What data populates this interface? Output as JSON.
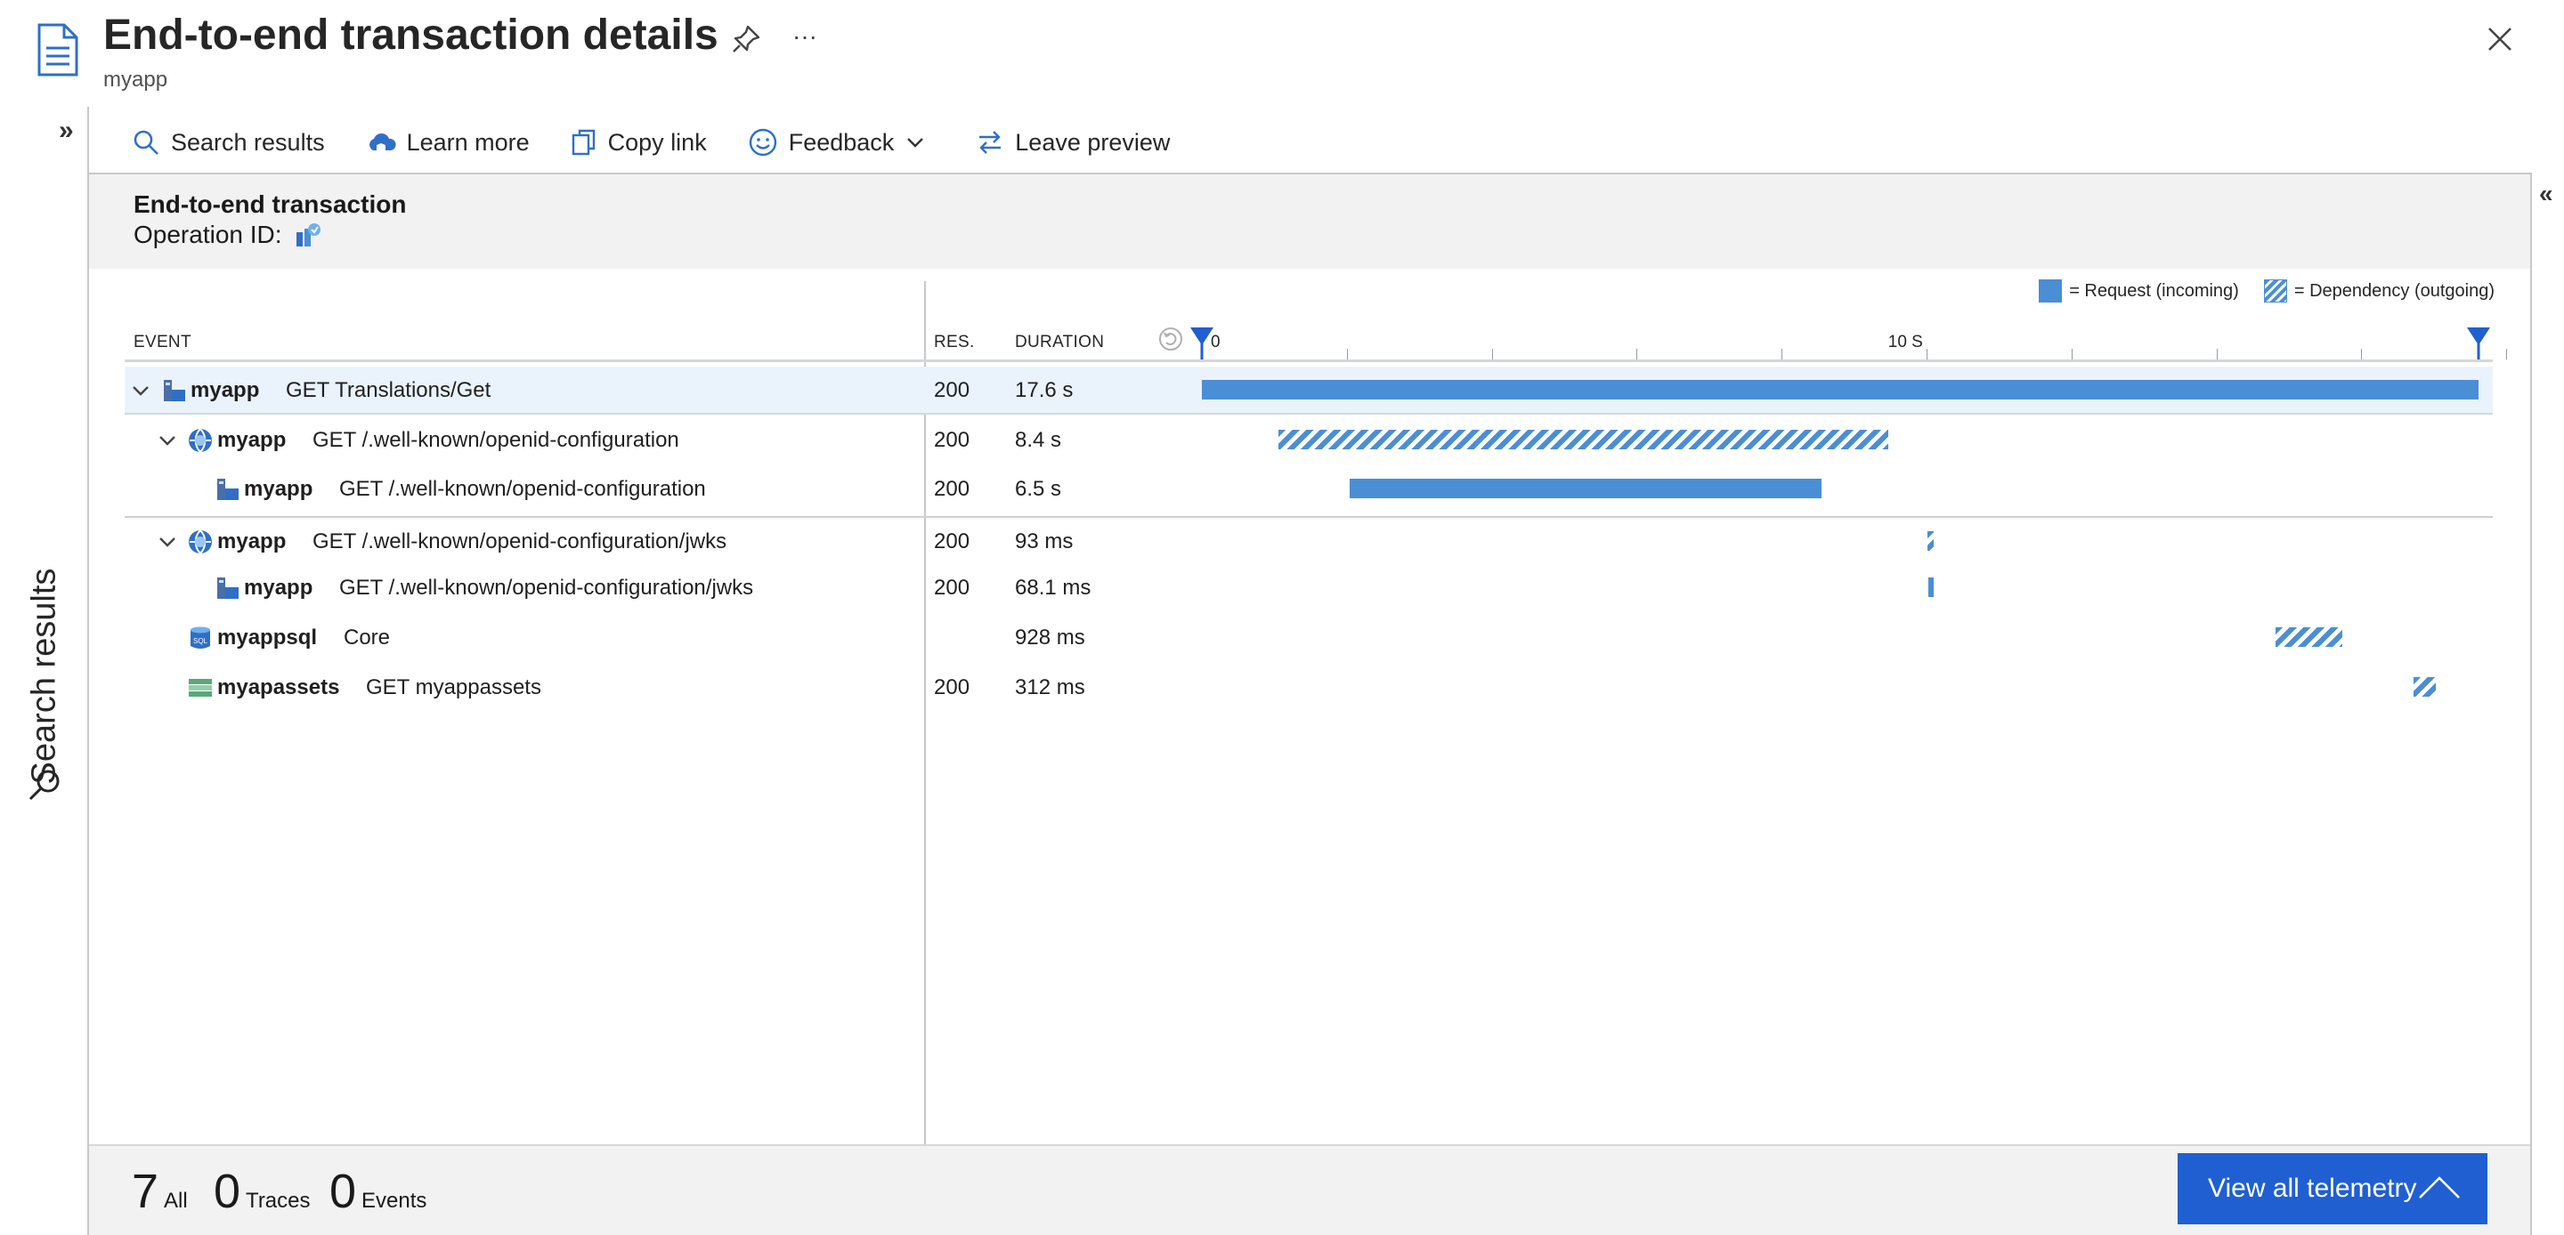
{
  "header": {
    "title": "End-to-end transaction details",
    "subtitle": "myapp",
    "more_glyph": "···"
  },
  "rail": {
    "label": "Search results",
    "expand_glyph": "»"
  },
  "right_panel": {
    "collapse_glyph": "«"
  },
  "toolbar": {
    "search_results": "Search results",
    "learn_more": "Learn more",
    "copy_link": "Copy link",
    "feedback": "Feedback",
    "leave_preview": "Leave preview"
  },
  "transaction": {
    "title": "End-to-end transaction",
    "operation_label": "Operation ID:"
  },
  "legend": {
    "request": "= Request (incoming)",
    "dependency": "= Dependency (outgoing)"
  },
  "columns": {
    "event": "EVENT",
    "res": "RES.",
    "duration": "DURATION"
  },
  "timeline": {
    "start_label": "0",
    "mid_label": "10 S",
    "total_seconds": 17.6
  },
  "rows": [
    {
      "app": "myapp",
      "name": "GET Translations/Get",
      "res": "200",
      "duration": "17.6 s",
      "icon": "app-service-icon",
      "kind": "request",
      "indent": 0,
      "caret": true,
      "start_s": 0,
      "dur_s": 17.6
    },
    {
      "app": "myapp",
      "name": "GET /.well-known/openid-configuration",
      "res": "200",
      "duration": "8.4 s",
      "icon": "http-dependency-icon",
      "kind": "dependency",
      "indent": 1,
      "caret": true,
      "start_s": 1.06,
      "dur_s": 8.4
    },
    {
      "app": "myapp",
      "name": "GET /.well-known/openid-configuration",
      "res": "200",
      "duration": "6.5 s",
      "icon": "app-service-icon",
      "kind": "request",
      "indent": 2,
      "caret": false,
      "start_s": 2.04,
      "dur_s": 6.5
    },
    {
      "app": "myapp",
      "name": "GET /.well-known/openid-configuration/jwks",
      "res": "200",
      "duration": "93 ms",
      "icon": "http-dependency-icon",
      "kind": "dependency",
      "indent": 1,
      "caret": true,
      "start_s": 10.0,
      "dur_s": 0.093
    },
    {
      "app": "myapp",
      "name": "GET /.well-known/openid-configuration/jwks",
      "res": "200",
      "duration": "68.1 ms",
      "icon": "app-service-icon",
      "kind": "request",
      "indent": 2,
      "caret": false,
      "start_s": 10.01,
      "dur_s": 0.068
    },
    {
      "app": "myappsql",
      "name": "Core",
      "res": "",
      "duration": "928 ms",
      "icon": "sql-database-icon",
      "kind": "dependency",
      "indent": 1,
      "caret": false,
      "start_s": 14.8,
      "dur_s": 0.928
    },
    {
      "app": "myapassets",
      "name": "GET myappassets",
      "res": "200",
      "duration": "312 ms",
      "icon": "storage-icon",
      "kind": "dependency",
      "indent": 1,
      "caret": false,
      "start_s": 16.7,
      "dur_s": 0.312
    }
  ],
  "footer": {
    "all_count": "7",
    "all_label": "All",
    "traces_count": "0",
    "traces_label": "Traces",
    "events_count": "0",
    "events_label": "Events",
    "view_all": "View all telemetry"
  },
  "colors": {
    "bar": "#4a8ed6",
    "primary_button": "#1f5fd1",
    "marker": "#1f5fd1"
  }
}
